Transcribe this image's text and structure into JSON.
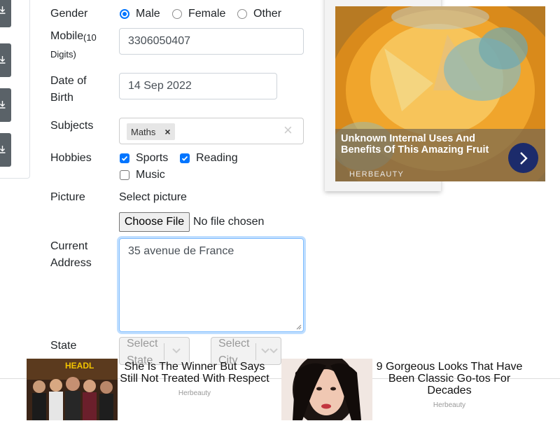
{
  "form": {
    "gender": {
      "label": "Gender",
      "options": [
        "Male",
        "Female",
        "Other"
      ],
      "selected": "Male"
    },
    "mobile": {
      "label": "Mobile",
      "hint": "(10 Digits)",
      "value": "3306050407"
    },
    "dob": {
      "label_line1": "Date of",
      "label_line2": "Birth",
      "value": "14 Sep 2022"
    },
    "subjects": {
      "label": "Subjects",
      "chips": [
        "Maths"
      ],
      "chip_remove": "×",
      "clear": "×"
    },
    "hobbies": {
      "label": "Hobbies",
      "options": [
        {
          "label": "Sports",
          "checked": true
        },
        {
          "label": "Reading",
          "checked": true
        },
        {
          "label": "Music",
          "checked": false
        }
      ]
    },
    "picture": {
      "label": "Picture",
      "select_text": "Select picture",
      "button": "Choose File",
      "status": "No file chosen"
    },
    "address": {
      "label_line1": "Current",
      "label_line2": "Address",
      "value": "35 avenue de France"
    },
    "state": {
      "label": "State",
      "placeholder_line1": "Select",
      "placeholder_line2": "State"
    },
    "city": {
      "placeholder_line1": "Select",
      "placeholder_line2": "City"
    }
  },
  "side_ad": {
    "title": "Unknown Internal Uses And Benefits Of This Amazing Fruit",
    "brand": "HERBEAUTY",
    "next_icon": "chevron-right-icon"
  },
  "bottom_ads": [
    {
      "title": "She Is The Winner But Says Still Not Treated With Respect",
      "brand": "Herbeauty"
    },
    {
      "title": "9 Gorgeous Looks That Have Been Classic Go-tos For Decades",
      "brand": "Herbeauty"
    }
  ],
  "colors": {
    "accent": "#0075ff",
    "focus_border": "#80bdff",
    "sidebar_button": "#5a6268",
    "ad_button": "#1c2b6b"
  }
}
